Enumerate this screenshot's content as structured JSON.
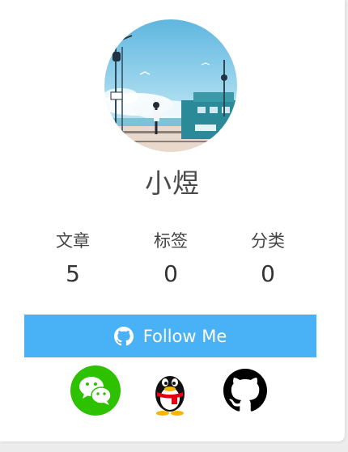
{
  "profile": {
    "name": "小煜"
  },
  "stats": [
    {
      "label": "文章",
      "value": "5"
    },
    {
      "label": "标签",
      "value": "0"
    },
    {
      "label": "分类",
      "value": "0"
    }
  ],
  "follow": {
    "label": "Follow Me",
    "icon": "github-icon"
  },
  "social": [
    {
      "name": "wechat",
      "icon": "wechat-icon",
      "color": "#2dc100"
    },
    {
      "name": "qq",
      "icon": "qq-penguin-icon",
      "color": "#000000"
    },
    {
      "name": "github",
      "icon": "github-icon",
      "color": "#000000"
    }
  ],
  "colors": {
    "accent": "#49b1f5",
    "text": "#444444",
    "card": "#ffffff"
  }
}
